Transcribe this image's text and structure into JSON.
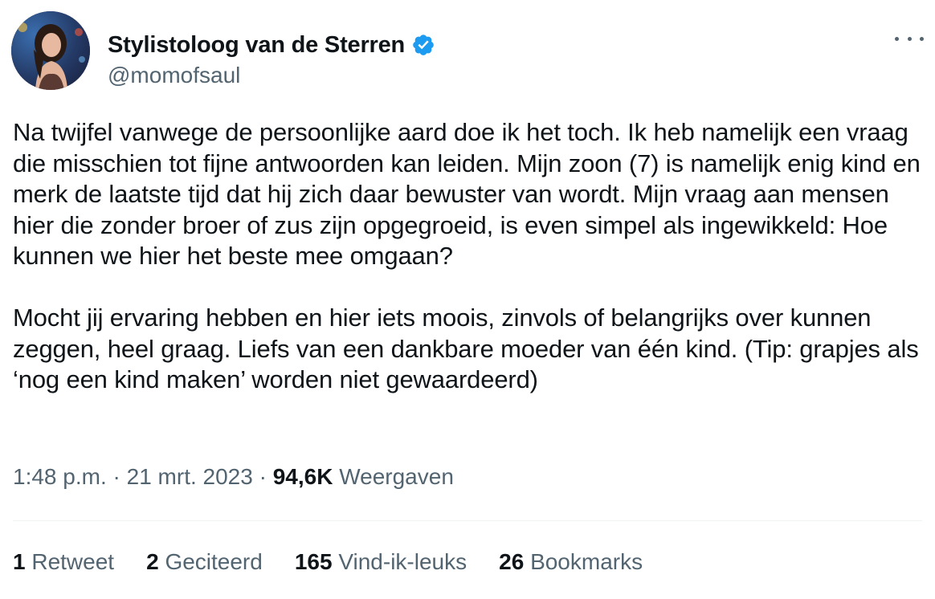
{
  "author": {
    "display_name": "Stylistoloog van de Sterren",
    "handle": "@momofsaul",
    "verified": true,
    "verified_color": "#1d9bf0"
  },
  "tweet": {
    "paragraphs": [
      "Na twijfel vanwege de persoonlijke aard doe ik het toch. Ik heb namelijk een vraag die misschien tot fijne antwoorden kan leiden. Mijn zoon (7) is namelijk enig kind en merk de laatste tijd dat hij zich daar bewuster van wordt. Mijn vraag aan mensen hier die zonder broer of zus zijn opgegroeid, is even simpel als ingewikkeld: Hoe kunnen we hier het beste mee omgaan?",
      "Mocht jij ervaring hebben en hier iets moois, zinvols of belangrijks over kunnen zeggen, heel graag. Liefs van een dankbare moeder van één kind. (Tip: grapjes als ‘nog een kind maken’ worden niet gewaardeerd)"
    ],
    "time": "1:48 p.m.",
    "separator": " · ",
    "date": "21 mrt. 2023",
    "views_count": "94,6K",
    "views_label": "Weergaven"
  },
  "stats": {
    "retweets": {
      "count": "1",
      "label": "Retweet"
    },
    "quotes": {
      "count": "2",
      "label": "Geciteerd"
    },
    "likes": {
      "count": "165",
      "label": "Vind-ik-leuks"
    },
    "bookmarks": {
      "count": "26",
      "label": "Bookmarks"
    }
  },
  "icons": {
    "avatar": "profile-photo",
    "verified": "verified-badge-icon",
    "more": "more-options-icon"
  }
}
